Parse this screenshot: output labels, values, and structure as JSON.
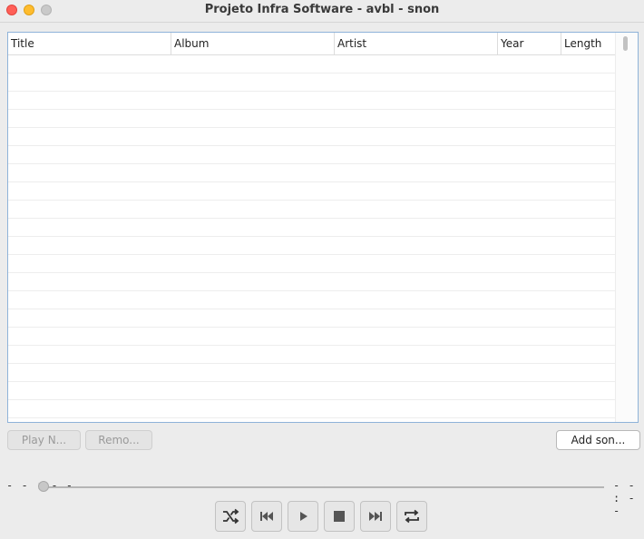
{
  "window": {
    "title": "Projeto Infra Software - avbl - snon"
  },
  "table": {
    "columns": [
      "Title",
      "Album",
      "Artist",
      "Year",
      "Length"
    ],
    "rows": []
  },
  "actions": {
    "play_now_label": "Play N...",
    "remove_label": "Remo...",
    "add_song_label": "Add son..."
  },
  "progress": {
    "current_time": "- - : - -",
    "total_time": "- - : - -",
    "fraction": 0
  },
  "controls": {
    "icons": [
      "shuffle-icon",
      "previous-icon",
      "play-icon",
      "stop-icon",
      "next-icon",
      "repeat-icon"
    ]
  },
  "colors": {
    "close": "#ff5f57",
    "minimize": "#febc2e",
    "maximize_disabled": "#c9c9c9",
    "table_focus_border": "#8fb3d9"
  }
}
